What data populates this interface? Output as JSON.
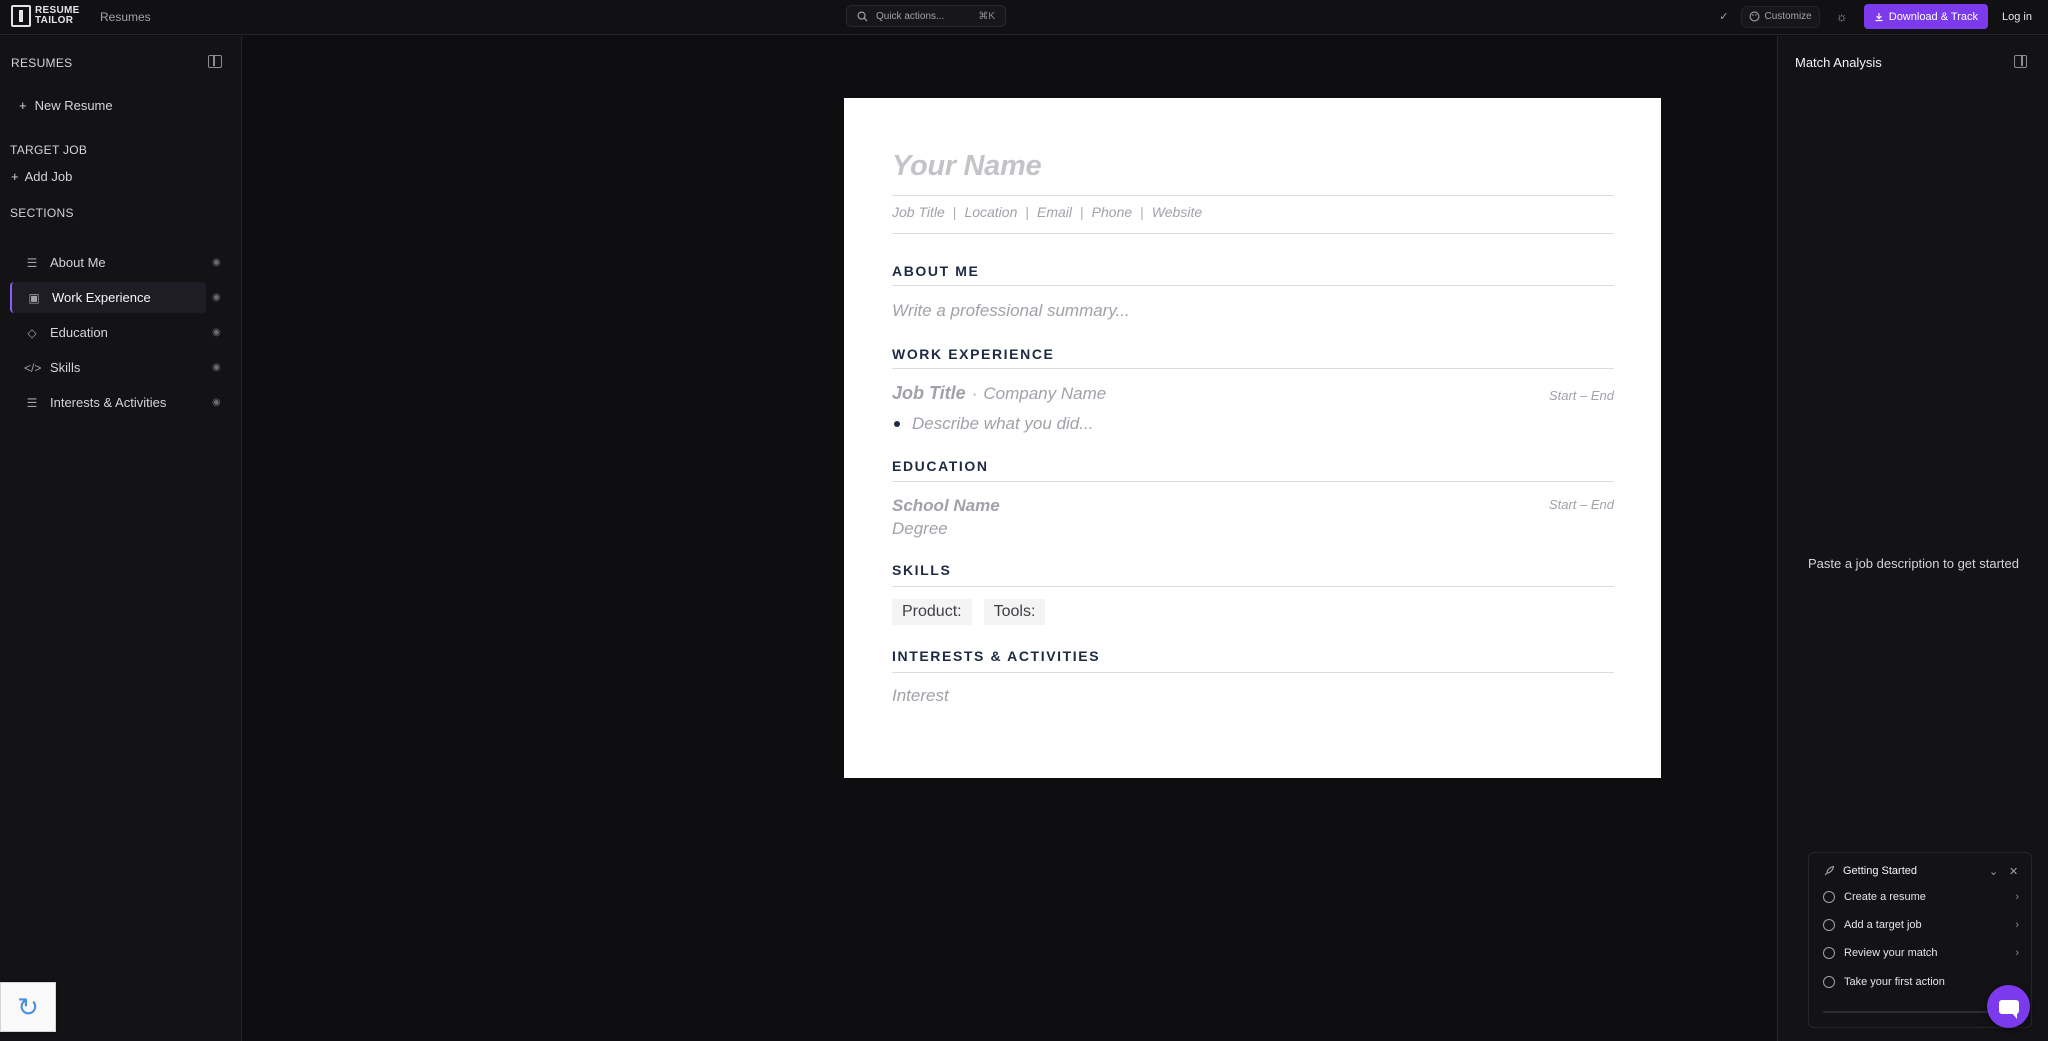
{
  "app": {
    "logo_line1": "RESUME",
    "logo_line2": "TAILOR"
  },
  "topbar": {
    "nav_resumes": "Resumes",
    "quick_actions": "Quick actions...",
    "shortcut": "⌘K",
    "check": "✓",
    "customize": "Customize",
    "download": "Download & Track",
    "login": "Log in"
  },
  "sidebar": {
    "resumes_heading": "RESUMES",
    "new_resume": "New Resume",
    "target_job_heading": "TARGET JOB",
    "add_job": "Add Job",
    "sections_heading": "SECTIONS",
    "items": [
      {
        "label": "About Me",
        "icon": "align-left-icon"
      },
      {
        "label": "Work Experience",
        "icon": "briefcase-icon",
        "active": true
      },
      {
        "label": "Education",
        "icon": "graduation-cap-icon"
      },
      {
        "label": "Skills",
        "icon": "code-icon"
      },
      {
        "label": "Interests & Activities",
        "icon": "align-left-icon"
      }
    ]
  },
  "resume": {
    "name": "Your Name",
    "contact": [
      "Job Title",
      "Location",
      "Email",
      "Phone",
      "Website"
    ],
    "sections": {
      "about": "ABOUT ME",
      "work": "WORK EXPERIENCE",
      "education": "EDUCATION",
      "skills": "SKILLS",
      "interests": "INTERESTS & ACTIVITIES"
    },
    "summary_placeholder": "Write a professional summary...",
    "job_title": "Job Title",
    "job_sep": "·",
    "company": "Company Name",
    "work_dates": "Start – End",
    "work_bullet": "Describe what you did...",
    "school": "School Name",
    "degree": "Degree",
    "edu_dates": "Start – End",
    "skill_chips": [
      "Product:",
      "Tools:"
    ],
    "interest": "Interest"
  },
  "match_panel": {
    "title": "Match Analysis",
    "empty": "Paste a job description to get started"
  },
  "getting_started": {
    "title": "Getting Started",
    "items": [
      "Create a resume",
      "Add a target job",
      "Review your match",
      "Take your first action"
    ]
  },
  "colors": {
    "accent": "#7c3aed",
    "heading": "#1e2a44",
    "background": "#0e0e10"
  }
}
